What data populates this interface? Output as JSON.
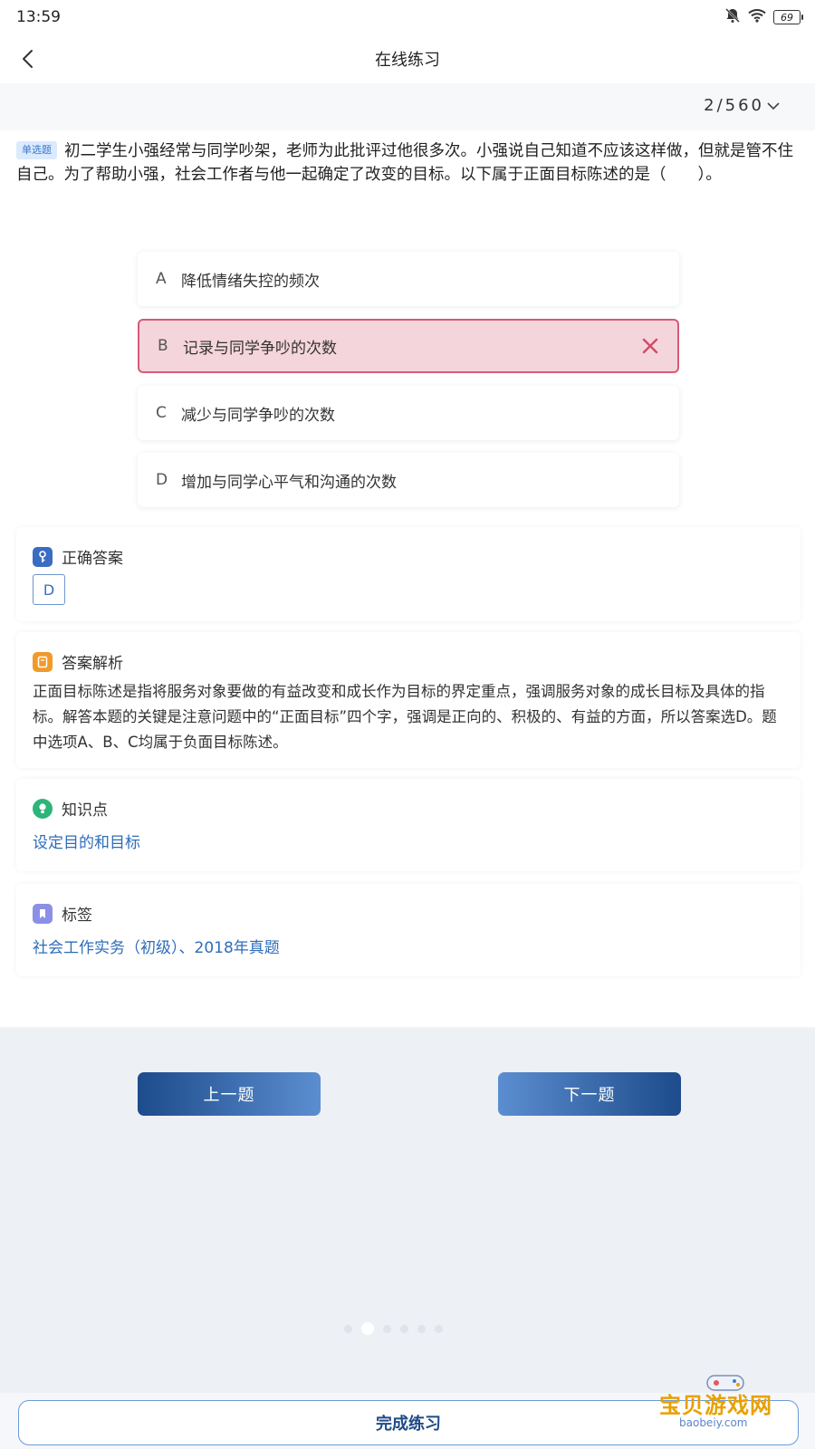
{
  "status_bar": {
    "time": "13:59",
    "battery": "69"
  },
  "header": {
    "title": "在线练习"
  },
  "progress": {
    "current": "2",
    "total": "560",
    "text": "2/560"
  },
  "question": {
    "type_badge": "单选题",
    "text": "初二学生小强经常与同学吵架，老师为此批评过他很多次。小强说自己知道不应该这样做，但就是管不住自己。为了帮助小强，社会工作者与他一起确定了改变的目标。以下属于正面目标陈述的是（　　）。"
  },
  "options": [
    {
      "letter": "A",
      "text": "降低情绪失控的频次"
    },
    {
      "letter": "B",
      "text": "记录与同学争吵的次数",
      "state": "wrong"
    },
    {
      "letter": "C",
      "text": "减少与同学争吵的次数"
    },
    {
      "letter": "D",
      "text": "增加与同学心平气和沟通的次数"
    }
  ],
  "correct_answer": {
    "label": "正确答案",
    "value": "D",
    "icon": "key-icon",
    "icon_color": "#3a6cc4"
  },
  "analysis": {
    "label": "答案解析",
    "icon": "book-icon",
    "icon_color": "#f09a2a",
    "text": "正面目标陈述是指将服务对象要做的有益改变和成长作为目标的界定重点，强调服务对象的成长目标及具体的指标。解答本题的关键是注意问题中的“正面目标”四个字，强调是正向的、积极的、有益的方面，所以答案选D。题中选项A、B、C均属于负面目标陈述。"
  },
  "knowledge": {
    "label": "知识点",
    "value": "设定目的和目标",
    "icon": "lightbulb-icon",
    "icon_color": "#2bb57a"
  },
  "tags": {
    "label": "标签",
    "value": "社会工作实务（初级）、2018年真题",
    "icon": "bookmark-icon",
    "icon_color": "#8c8fe6"
  },
  "nav": {
    "prev": "上一题",
    "next": "下一题"
  },
  "finish": {
    "label": "完成练习"
  },
  "watermark": {
    "title": "宝贝游戏网",
    "url": "baobeiy.com"
  },
  "colors": {
    "accent": "#1d4b8b",
    "link": "#2e6db8",
    "wrong_bg": "#f5d5dc",
    "wrong_border": "#d55b78"
  }
}
